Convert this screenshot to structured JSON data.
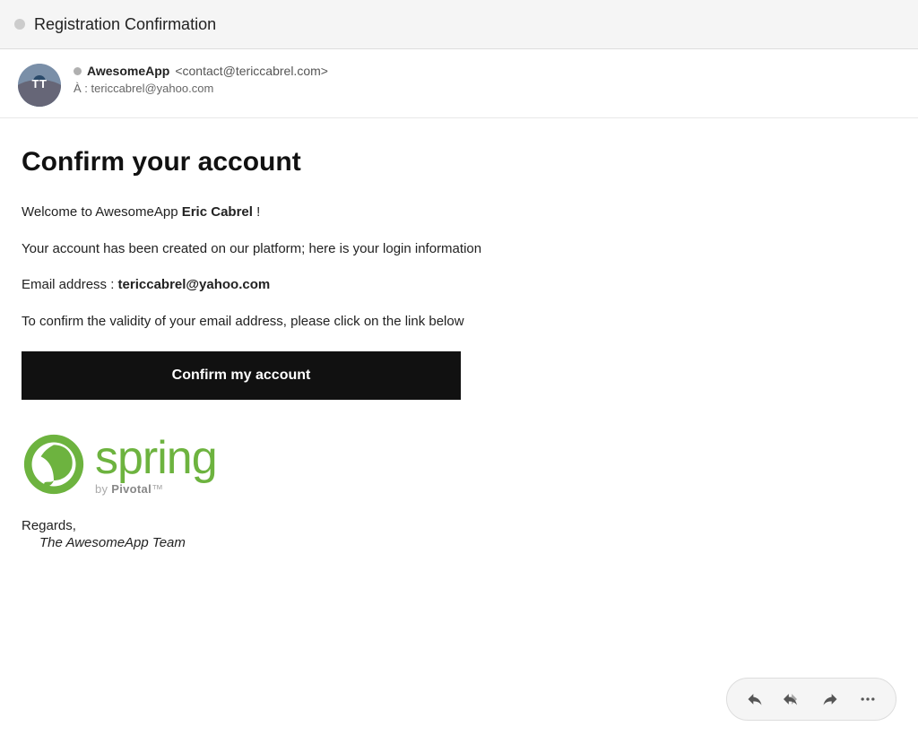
{
  "titleBar": {
    "title": "Registration Confirmation",
    "dotColor": "#cccccc"
  },
  "sender": {
    "avatarInitials": "TT",
    "name": "AwesomeApp",
    "email": "<contact@tericcabrel.com>",
    "to": "tericcabrel@yahoo.com",
    "onlineDotColor": "#b0b0b0"
  },
  "emailBody": {
    "heading": "Confirm your account",
    "paragraph1_prefix": "Welcome to AwesomeApp ",
    "paragraph1_name": "Eric Cabrel",
    "paragraph1_suffix": " !",
    "paragraph2": "Your account has been created on our platform; here is your login information",
    "paragraph3_prefix": "Email address : ",
    "paragraph3_email": "tericcabrel@yahoo.com",
    "paragraph4": "To confirm the validity of your email address, please click on the link below",
    "confirmButton": "Confirm my account",
    "regards1": "Regards,",
    "regards2": "The AwesomeApp Team",
    "springWord": "spring",
    "byPivotal": "by Pivotal™"
  },
  "toolbar": {
    "replyIcon": "reply-icon",
    "replyAllIcon": "reply-all-icon",
    "forwardIcon": "forward-icon",
    "moreIcon": "more-icon"
  }
}
